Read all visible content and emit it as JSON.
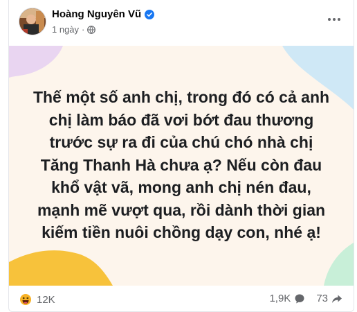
{
  "post": {
    "author": "Hoàng Nguyên Vũ",
    "time": "1 ngày",
    "text": "Thế một số anh chị, trong đó có cả anh\nchị làm báo đã vơi bớt đau thương\ntrước sự ra đi của chú chó nhà chị\nTăng Thanh Hà chưa ạ? Nếu còn đau\nkhổ vật vã, mong anh chị nén đau,\nmạnh mẽ vượt qua, rồi dành thời gian\nkiếm tiền nuôi chồng dạy con, nhé ạ!",
    "background_color": "#fdf5ec"
  },
  "stats": {
    "reactions": "12K",
    "comments": "1,9K",
    "shares": "73"
  },
  "colors": {
    "verified": "#1877f2",
    "text_secondary": "#65676b"
  }
}
